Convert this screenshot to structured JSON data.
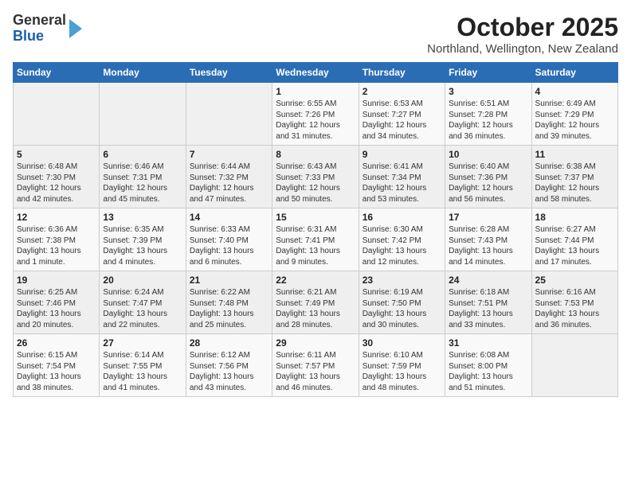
{
  "header": {
    "logo_line1": "General",
    "logo_line2": "Blue",
    "title": "October 2025",
    "subtitle": "Northland, Wellington, New Zealand"
  },
  "days_of_week": [
    "Sunday",
    "Monday",
    "Tuesday",
    "Wednesday",
    "Thursday",
    "Friday",
    "Saturday"
  ],
  "weeks": [
    [
      {
        "day": "",
        "info": ""
      },
      {
        "day": "",
        "info": ""
      },
      {
        "day": "",
        "info": ""
      },
      {
        "day": "1",
        "info": "Sunrise: 6:55 AM\nSunset: 7:26 PM\nDaylight: 12 hours\nand 31 minutes."
      },
      {
        "day": "2",
        "info": "Sunrise: 6:53 AM\nSunset: 7:27 PM\nDaylight: 12 hours\nand 34 minutes."
      },
      {
        "day": "3",
        "info": "Sunrise: 6:51 AM\nSunset: 7:28 PM\nDaylight: 12 hours\nand 36 minutes."
      },
      {
        "day": "4",
        "info": "Sunrise: 6:49 AM\nSunset: 7:29 PM\nDaylight: 12 hours\nand 39 minutes."
      }
    ],
    [
      {
        "day": "5",
        "info": "Sunrise: 6:48 AM\nSunset: 7:30 PM\nDaylight: 12 hours\nand 42 minutes."
      },
      {
        "day": "6",
        "info": "Sunrise: 6:46 AM\nSunset: 7:31 PM\nDaylight: 12 hours\nand 45 minutes."
      },
      {
        "day": "7",
        "info": "Sunrise: 6:44 AM\nSunset: 7:32 PM\nDaylight: 12 hours\nand 47 minutes."
      },
      {
        "day": "8",
        "info": "Sunrise: 6:43 AM\nSunset: 7:33 PM\nDaylight: 12 hours\nand 50 minutes."
      },
      {
        "day": "9",
        "info": "Sunrise: 6:41 AM\nSunset: 7:34 PM\nDaylight: 12 hours\nand 53 minutes."
      },
      {
        "day": "10",
        "info": "Sunrise: 6:40 AM\nSunset: 7:36 PM\nDaylight: 12 hours\nand 56 minutes."
      },
      {
        "day": "11",
        "info": "Sunrise: 6:38 AM\nSunset: 7:37 PM\nDaylight: 12 hours\nand 58 minutes."
      }
    ],
    [
      {
        "day": "12",
        "info": "Sunrise: 6:36 AM\nSunset: 7:38 PM\nDaylight: 13 hours\nand 1 minute."
      },
      {
        "day": "13",
        "info": "Sunrise: 6:35 AM\nSunset: 7:39 PM\nDaylight: 13 hours\nand 4 minutes."
      },
      {
        "day": "14",
        "info": "Sunrise: 6:33 AM\nSunset: 7:40 PM\nDaylight: 13 hours\nand 6 minutes."
      },
      {
        "day": "15",
        "info": "Sunrise: 6:31 AM\nSunset: 7:41 PM\nDaylight: 13 hours\nand 9 minutes."
      },
      {
        "day": "16",
        "info": "Sunrise: 6:30 AM\nSunset: 7:42 PM\nDaylight: 13 hours\nand 12 minutes."
      },
      {
        "day": "17",
        "info": "Sunrise: 6:28 AM\nSunset: 7:43 PM\nDaylight: 13 hours\nand 14 minutes."
      },
      {
        "day": "18",
        "info": "Sunrise: 6:27 AM\nSunset: 7:44 PM\nDaylight: 13 hours\nand 17 minutes."
      }
    ],
    [
      {
        "day": "19",
        "info": "Sunrise: 6:25 AM\nSunset: 7:46 PM\nDaylight: 13 hours\nand 20 minutes."
      },
      {
        "day": "20",
        "info": "Sunrise: 6:24 AM\nSunset: 7:47 PM\nDaylight: 13 hours\nand 22 minutes."
      },
      {
        "day": "21",
        "info": "Sunrise: 6:22 AM\nSunset: 7:48 PM\nDaylight: 13 hours\nand 25 minutes."
      },
      {
        "day": "22",
        "info": "Sunrise: 6:21 AM\nSunset: 7:49 PM\nDaylight: 13 hours\nand 28 minutes."
      },
      {
        "day": "23",
        "info": "Sunrise: 6:19 AM\nSunset: 7:50 PM\nDaylight: 13 hours\nand 30 minutes."
      },
      {
        "day": "24",
        "info": "Sunrise: 6:18 AM\nSunset: 7:51 PM\nDaylight: 13 hours\nand 33 minutes."
      },
      {
        "day": "25",
        "info": "Sunrise: 6:16 AM\nSunset: 7:53 PM\nDaylight: 13 hours\nand 36 minutes."
      }
    ],
    [
      {
        "day": "26",
        "info": "Sunrise: 6:15 AM\nSunset: 7:54 PM\nDaylight: 13 hours\nand 38 minutes."
      },
      {
        "day": "27",
        "info": "Sunrise: 6:14 AM\nSunset: 7:55 PM\nDaylight: 13 hours\nand 41 minutes."
      },
      {
        "day": "28",
        "info": "Sunrise: 6:12 AM\nSunset: 7:56 PM\nDaylight: 13 hours\nand 43 minutes."
      },
      {
        "day": "29",
        "info": "Sunrise: 6:11 AM\nSunset: 7:57 PM\nDaylight: 13 hours\nand 46 minutes."
      },
      {
        "day": "30",
        "info": "Sunrise: 6:10 AM\nSunset: 7:59 PM\nDaylight: 13 hours\nand 48 minutes."
      },
      {
        "day": "31",
        "info": "Sunrise: 6:08 AM\nSunset: 8:00 PM\nDaylight: 13 hours\nand 51 minutes."
      },
      {
        "day": "",
        "info": ""
      }
    ]
  ]
}
